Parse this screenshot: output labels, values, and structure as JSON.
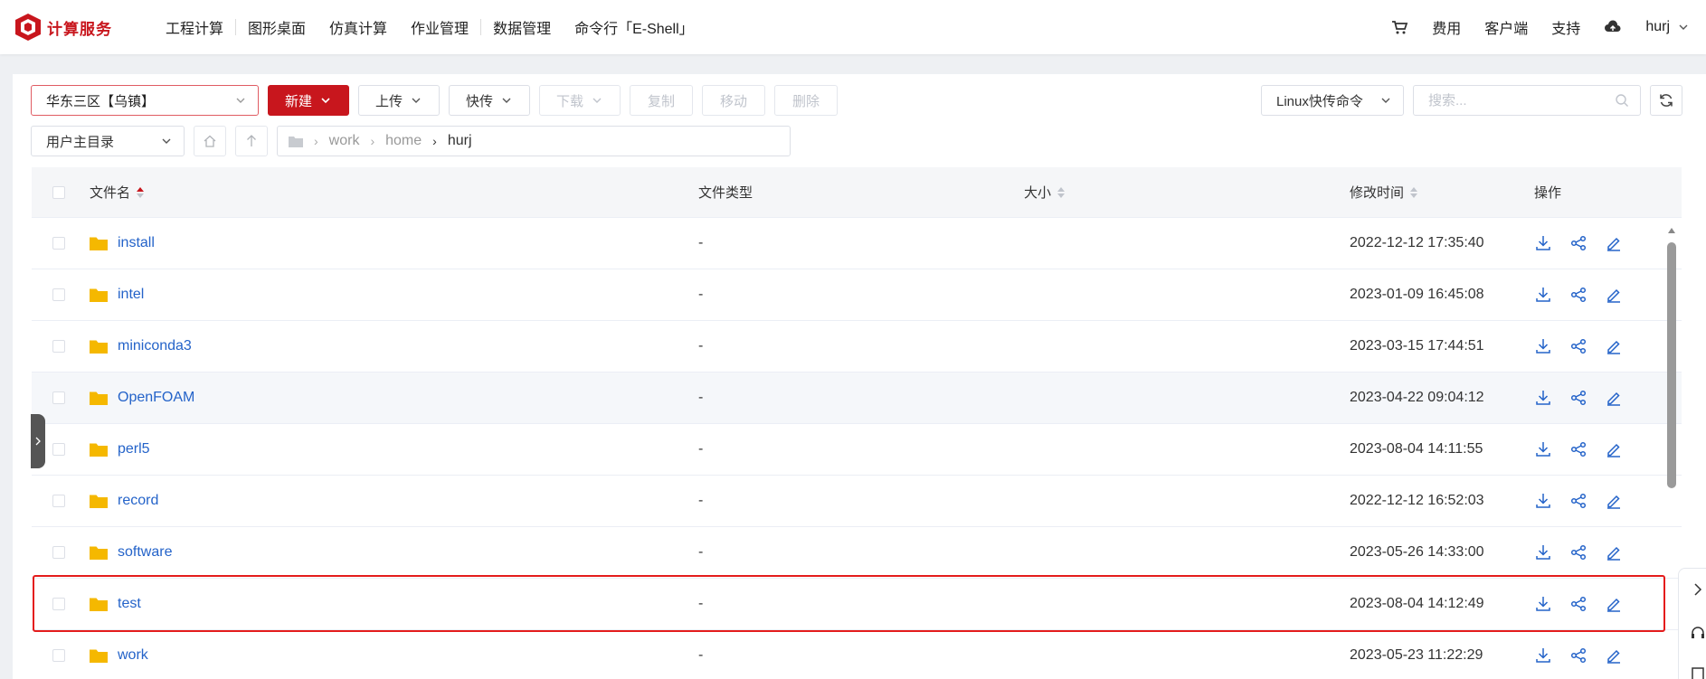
{
  "brand": {
    "name": "计算服务",
    "color": "#c8161d"
  },
  "nav": [
    {
      "label": "工程计算"
    },
    {
      "label": "图形桌面"
    },
    {
      "label": "仿真计算"
    },
    {
      "label": "作业管理"
    },
    {
      "label": "数据管理"
    },
    {
      "label": "命令行「E-Shell」"
    }
  ],
  "header_right": {
    "fees": "费用",
    "client": "客户端",
    "support": "支持",
    "user": "hurj"
  },
  "toolbar": {
    "region": "华东三区【乌镇】",
    "new": "新建",
    "upload": "上传",
    "fast_transfer": "快传",
    "download": "下载",
    "copy": "复制",
    "move": "移动",
    "delete": "删除",
    "linux_cmd": "Linux快传命令",
    "search_placeholder": "搜索..."
  },
  "dir_select": "用户主目录",
  "breadcrumb": [
    "work",
    "home",
    "hurj"
  ],
  "table": {
    "headers": {
      "name": "文件名",
      "type": "文件类型",
      "size": "大小",
      "mtime": "修改时间",
      "ops": "操作"
    },
    "rows": [
      {
        "name": "install",
        "type": "-",
        "size": "",
        "mtime": "2022-12-12 17:35:40"
      },
      {
        "name": "intel",
        "type": "-",
        "size": "",
        "mtime": "2023-01-09 16:45:08"
      },
      {
        "name": "miniconda3",
        "type": "-",
        "size": "",
        "mtime": "2023-03-15 17:44:51"
      },
      {
        "name": "OpenFOAM",
        "type": "-",
        "size": "",
        "mtime": "2023-04-22 09:04:12"
      },
      {
        "name": "perl5",
        "type": "-",
        "size": "",
        "mtime": "2023-08-04 14:11:55"
      },
      {
        "name": "record",
        "type": "-",
        "size": "",
        "mtime": "2022-12-12 16:52:03"
      },
      {
        "name": "software",
        "type": "-",
        "size": "",
        "mtime": "2023-05-26 14:33:00"
      },
      {
        "name": "test",
        "type": "-",
        "size": "",
        "mtime": "2023-08-04 14:12:49"
      },
      {
        "name": "work",
        "type": "-",
        "size": "",
        "mtime": "2023-05-23 11:22:29"
      }
    ]
  },
  "colors": {
    "link": "#2463c9",
    "folder": "#f5b800",
    "highlight": "#e41c1c"
  }
}
